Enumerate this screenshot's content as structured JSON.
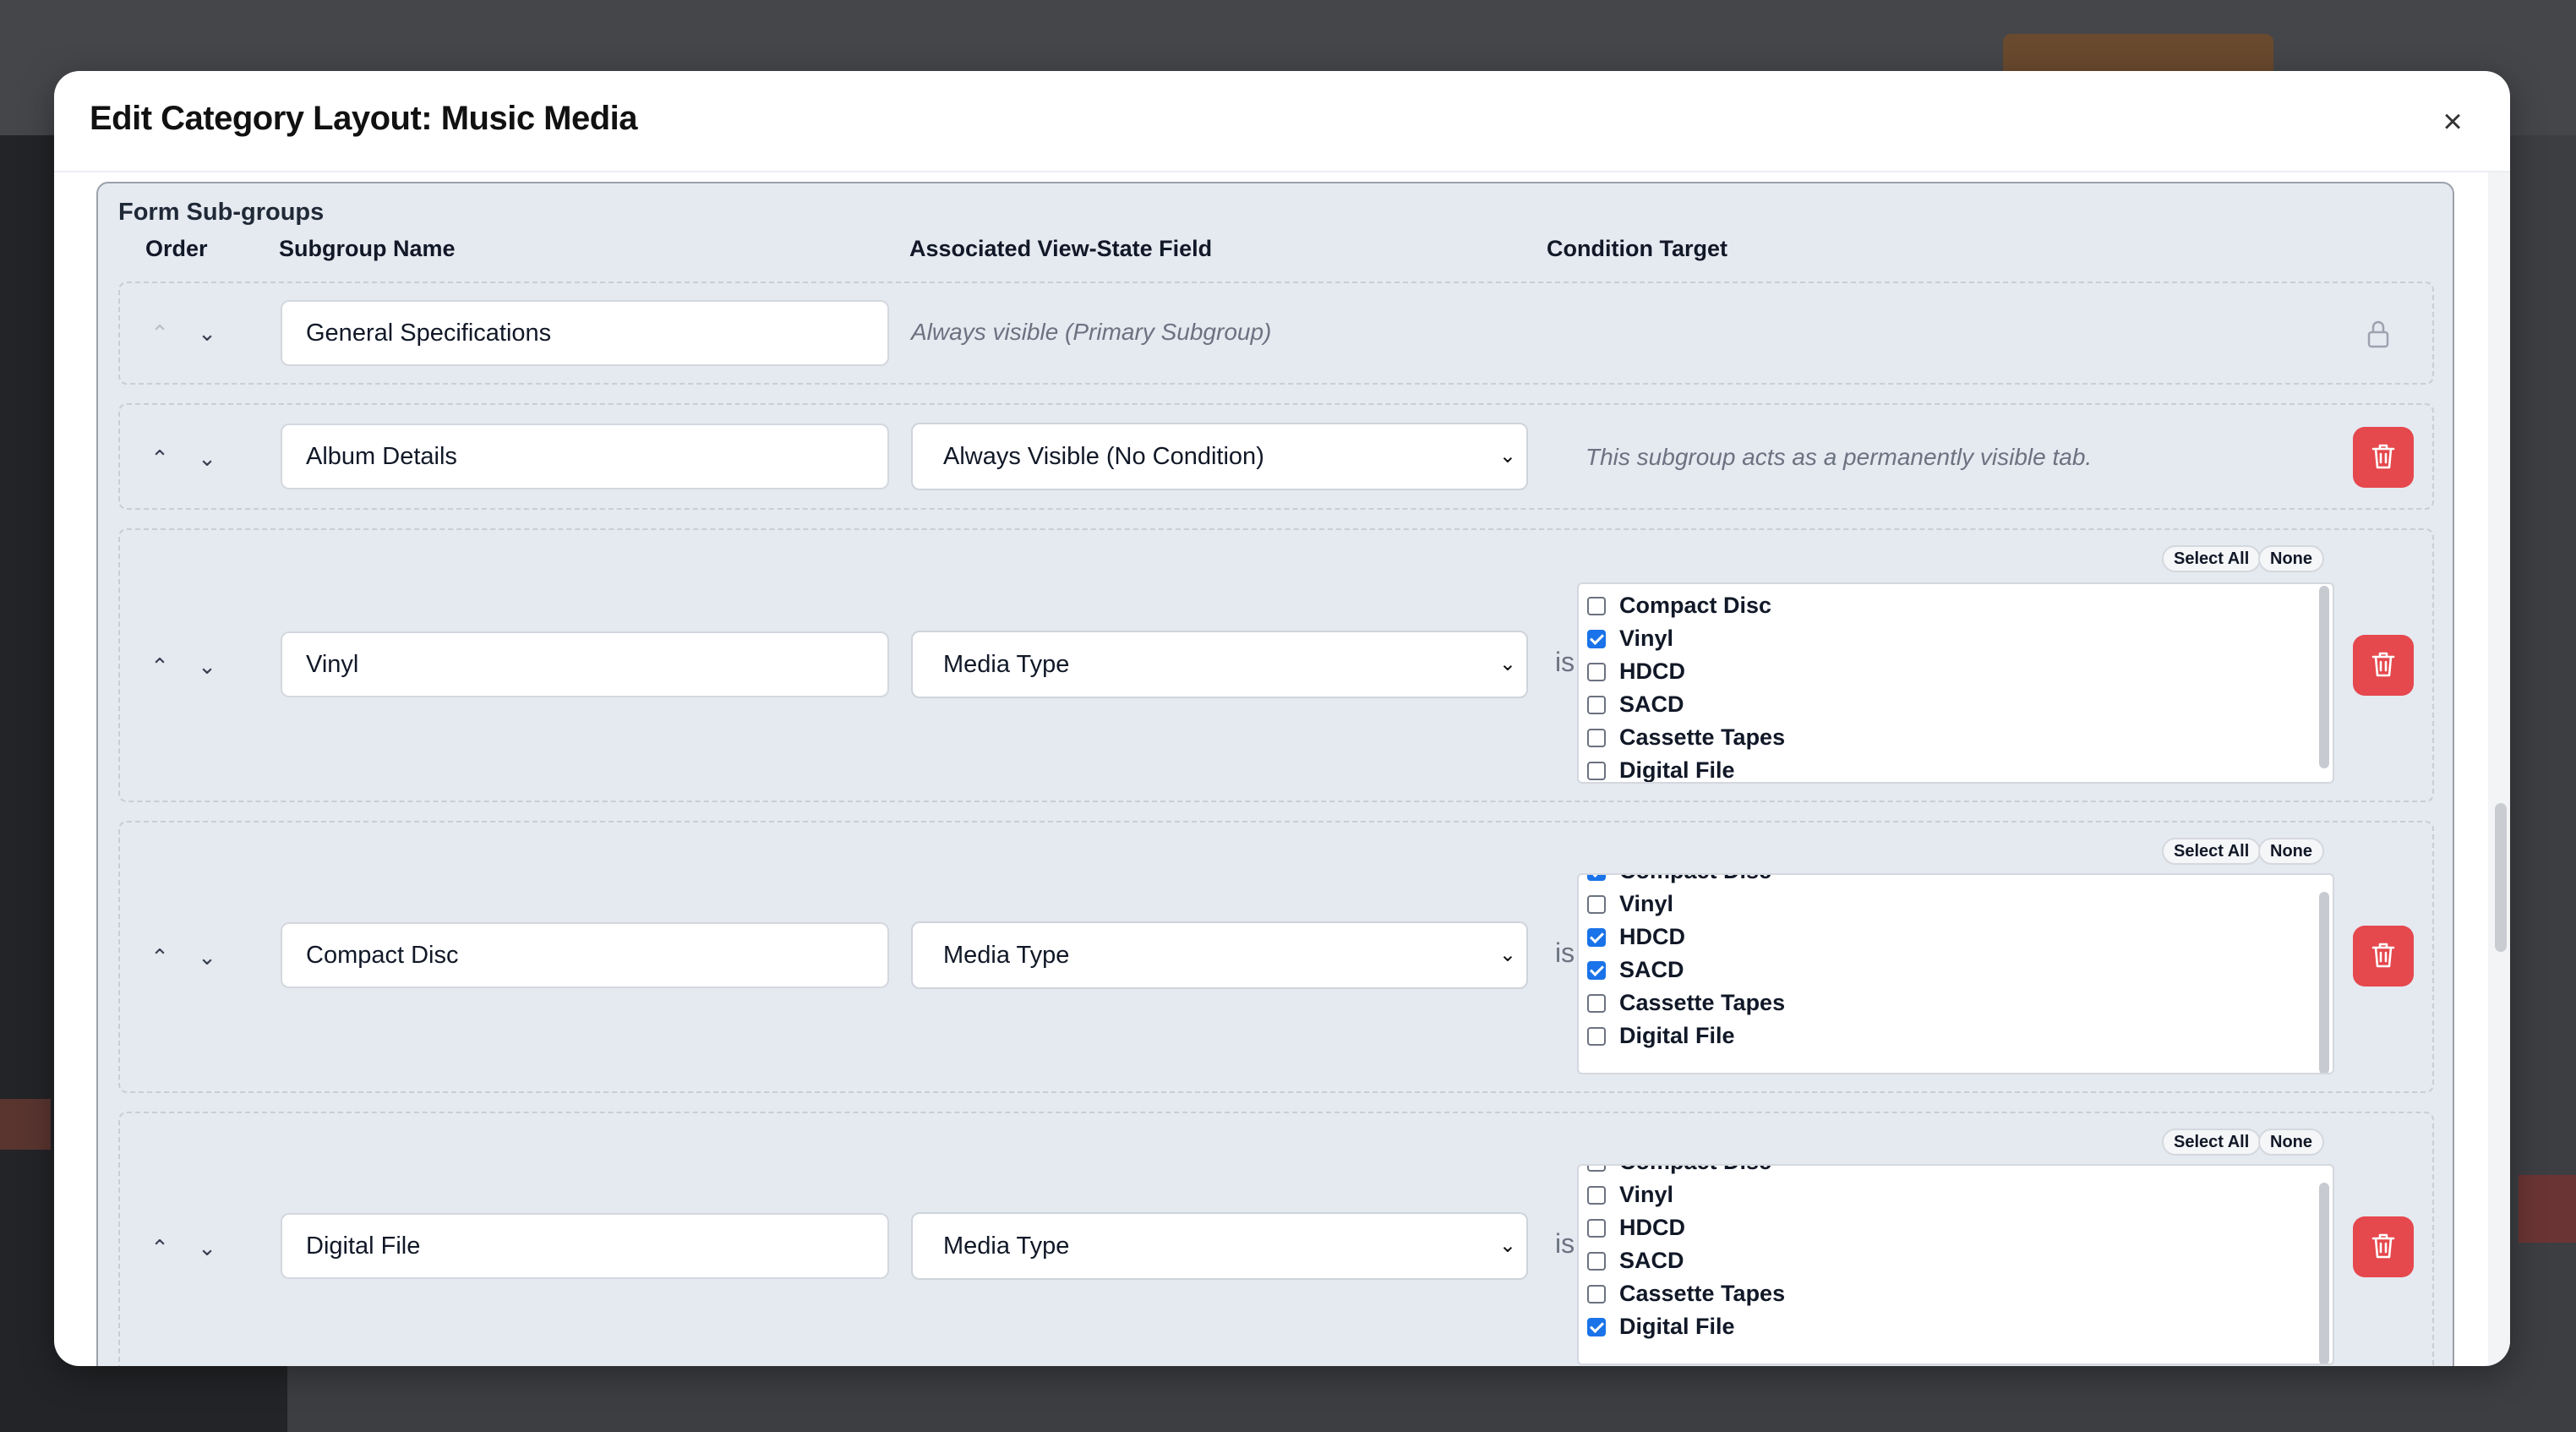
{
  "modal": {
    "title": "Edit Category Layout: Music Media",
    "close_label": "×"
  },
  "section": {
    "title": "Form Sub-groups",
    "headers": {
      "order": "Order",
      "name": "Subgroup Name",
      "field": "Associated View-State Field",
      "target": "Condition Target"
    }
  },
  "rows": [
    {
      "name": "General Specifications",
      "note": "Always visible (Primary Subgroup)",
      "locked": true
    },
    {
      "name": "Album Details",
      "field": "Always Visible (No Condition)",
      "note": "This subgroup acts as a permanently visible tab."
    },
    {
      "name": "Vinyl",
      "field": "Media Type",
      "is_label": "is",
      "select_all": "Select All",
      "none": "None",
      "options": [
        "Compact Disc",
        "Vinyl",
        "HDCD",
        "SACD",
        "Cassette Tapes",
        "Digital File"
      ],
      "checked": [
        false,
        true,
        false,
        false,
        false,
        false
      ]
    },
    {
      "name": "Compact Disc",
      "field": "Media Type",
      "is_label": "is",
      "select_all": "Select All",
      "none": "None",
      "options": [
        "Compact Disc",
        "Vinyl",
        "HDCD",
        "SACD",
        "Cassette Tapes",
        "Digital File"
      ],
      "checked": [
        true,
        false,
        true,
        true,
        false,
        false
      ]
    },
    {
      "name": "Digital File",
      "field": "Media Type",
      "is_label": "is",
      "select_all": "Select All",
      "none": "None",
      "options": [
        "Compact Disc",
        "Vinyl",
        "HDCD",
        "SACD",
        "Cassette Tapes",
        "Digital File"
      ],
      "checked": [
        false,
        false,
        false,
        false,
        false,
        true
      ]
    }
  ],
  "icons": {
    "up": "chevron-up-icon",
    "down": "chevron-down-icon",
    "lock": "lock-icon",
    "delete": "trash-icon",
    "close": "close-icon"
  },
  "colors": {
    "delete_button": "#e5484d",
    "checkbox_checked": "#1a73e8",
    "section_bg": "#e5e9f0"
  }
}
